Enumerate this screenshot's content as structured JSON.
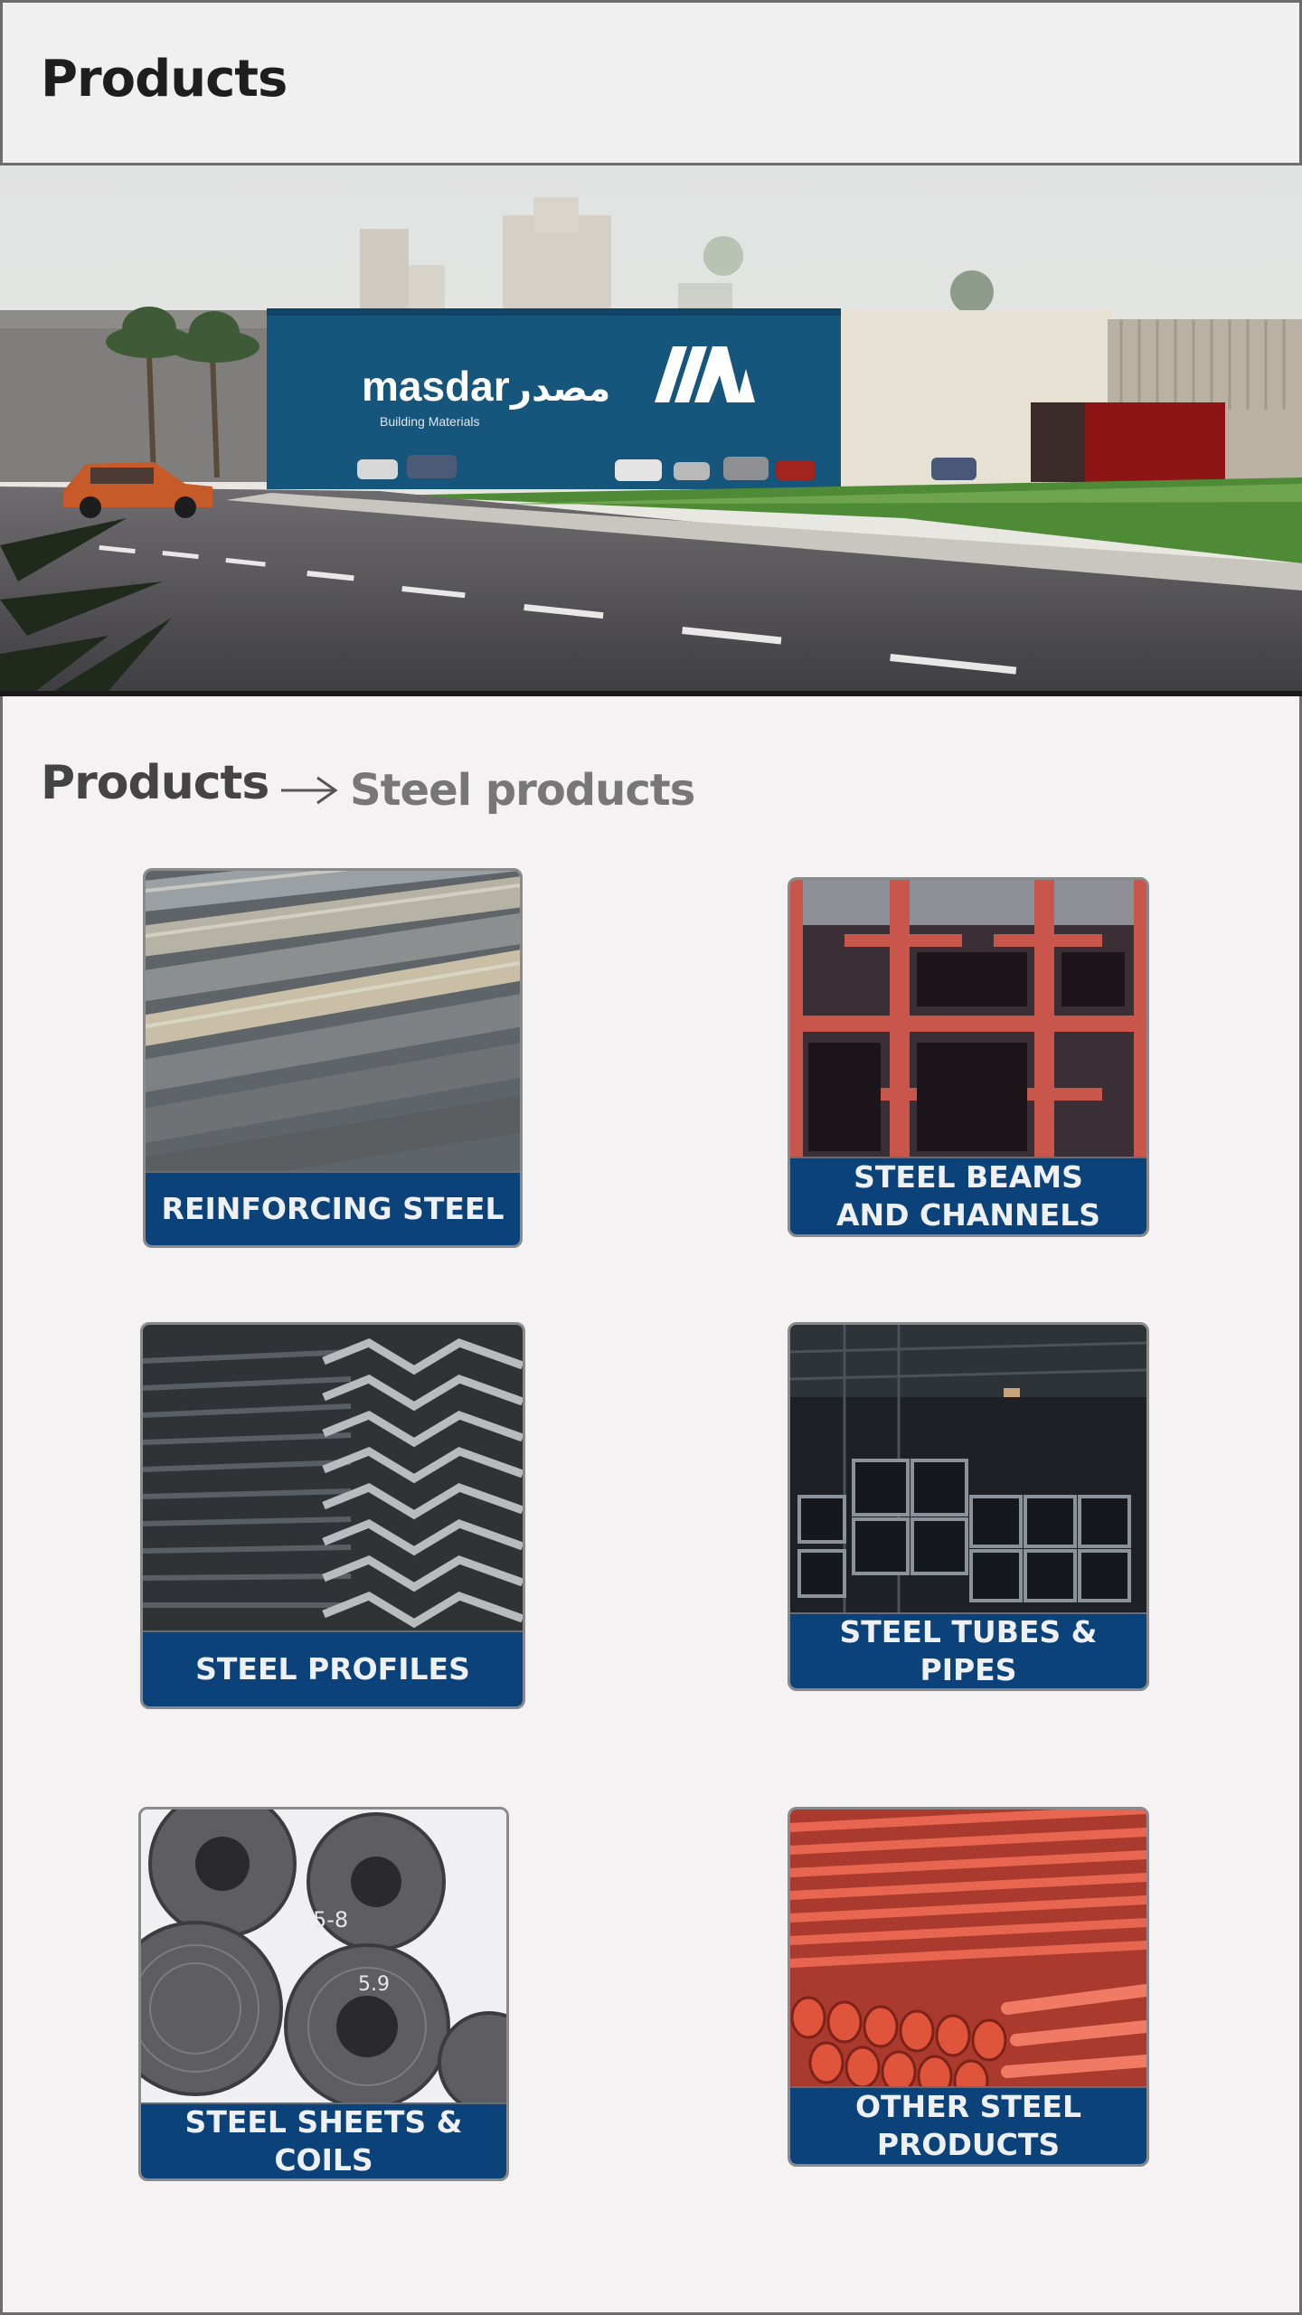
{
  "header": {
    "title": "Products"
  },
  "hero": {
    "logo_text": "masdar",
    "logo_arabic": "مصدر",
    "logo_sub": "Building Materials"
  },
  "breadcrumb": {
    "root": "Products",
    "current": "Steel products"
  },
  "products": [
    {
      "label": "REINFORCING STEEL"
    },
    {
      "label": "STEEL BEAMS AND CHANNELS"
    },
    {
      "label": "STEEL PROFILES"
    },
    {
      "label": "STEEL TUBES & PIPES"
    },
    {
      "label": "STEEL SHEETS & COILS"
    },
    {
      "label": "OTHER STEEL PRODUCTS"
    }
  ],
  "colors": {
    "caption_bg": "#0b4279",
    "caption_text": "#eef0f4",
    "page_bg": "#f4f2f3"
  }
}
